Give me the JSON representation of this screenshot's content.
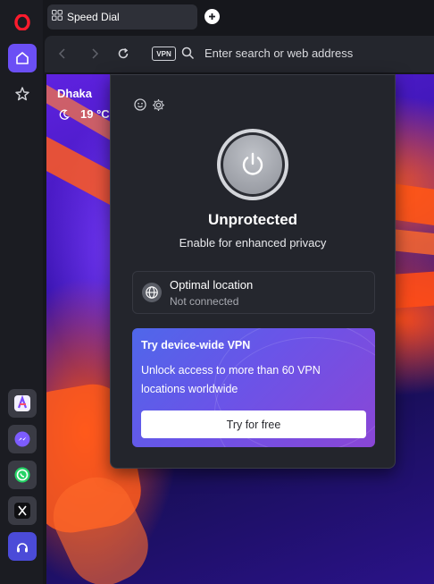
{
  "tabs": [
    {
      "label": "Speed Dial"
    }
  ],
  "address_bar": {
    "vpn_badge": "VPN",
    "placeholder": "Enter search or web address"
  },
  "weather": {
    "city": "Dhaka",
    "temperature": "19 °C"
  },
  "vpn_popup": {
    "status_title": "Unprotected",
    "status_subtitle": "Enable for enhanced privacy",
    "location": {
      "name": "Optimal location",
      "status": "Not connected"
    },
    "promo": {
      "title": "Try device-wide VPN",
      "description": "Unlock access to more than 60 VPN locations worldwide",
      "button_label": "Try for free"
    }
  },
  "sidebar": {
    "items": [
      {
        "icon": "opera-logo-icon"
      },
      {
        "icon": "home-icon",
        "active": true
      },
      {
        "icon": "star-icon"
      }
    ],
    "apps": [
      {
        "icon": "aria-icon"
      },
      {
        "icon": "messenger-icon"
      },
      {
        "icon": "whatsapp-icon"
      },
      {
        "icon": "x-icon"
      },
      {
        "icon": "music-player-icon"
      }
    ]
  },
  "colors": {
    "accent": "#6b4ff5",
    "opera_red": "#ff1b2d",
    "popup_bg": "#23252c"
  }
}
